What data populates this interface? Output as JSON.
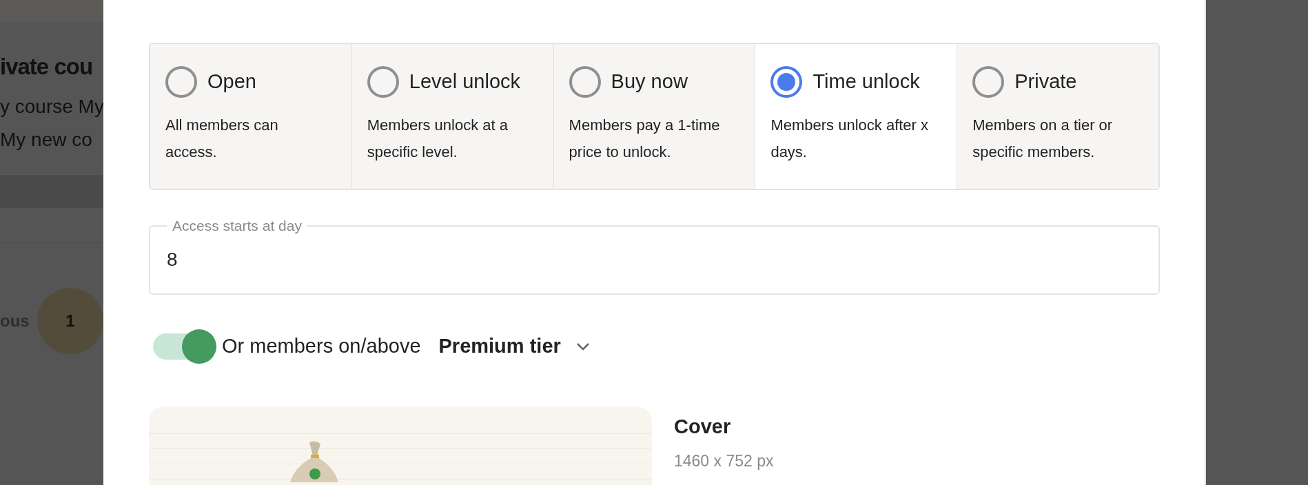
{
  "background_page": {
    "title": "ivate cou",
    "description_lines": [
      "y course My",
      "My new co"
    ],
    "pagination": {
      "previous_label": "ous",
      "pages": [
        {
          "label": "1",
          "selected": true
        }
      ]
    }
  },
  "access_options": [
    {
      "title": "Open",
      "description": "All members can access.",
      "selected": false
    },
    {
      "title": "Level unlock",
      "description": "Members unlock at a specific level.",
      "selected": false
    },
    {
      "title": "Buy now",
      "description": "Members pay a 1-time price to unlock.",
      "selected": false
    },
    {
      "title": "Time unlock",
      "description": "Members unlock after x days.",
      "selected": true
    },
    {
      "title": "Private",
      "description": "Members on a tier or specific members.",
      "selected": false
    }
  ],
  "access_day_field": {
    "label": "Access starts at day",
    "value": "8"
  },
  "tier_toggle": {
    "on": true,
    "label": "Or members on/above",
    "tier": "Premium tier"
  },
  "cover": {
    "title": "Cover",
    "size": "1460 x 752 px"
  }
}
